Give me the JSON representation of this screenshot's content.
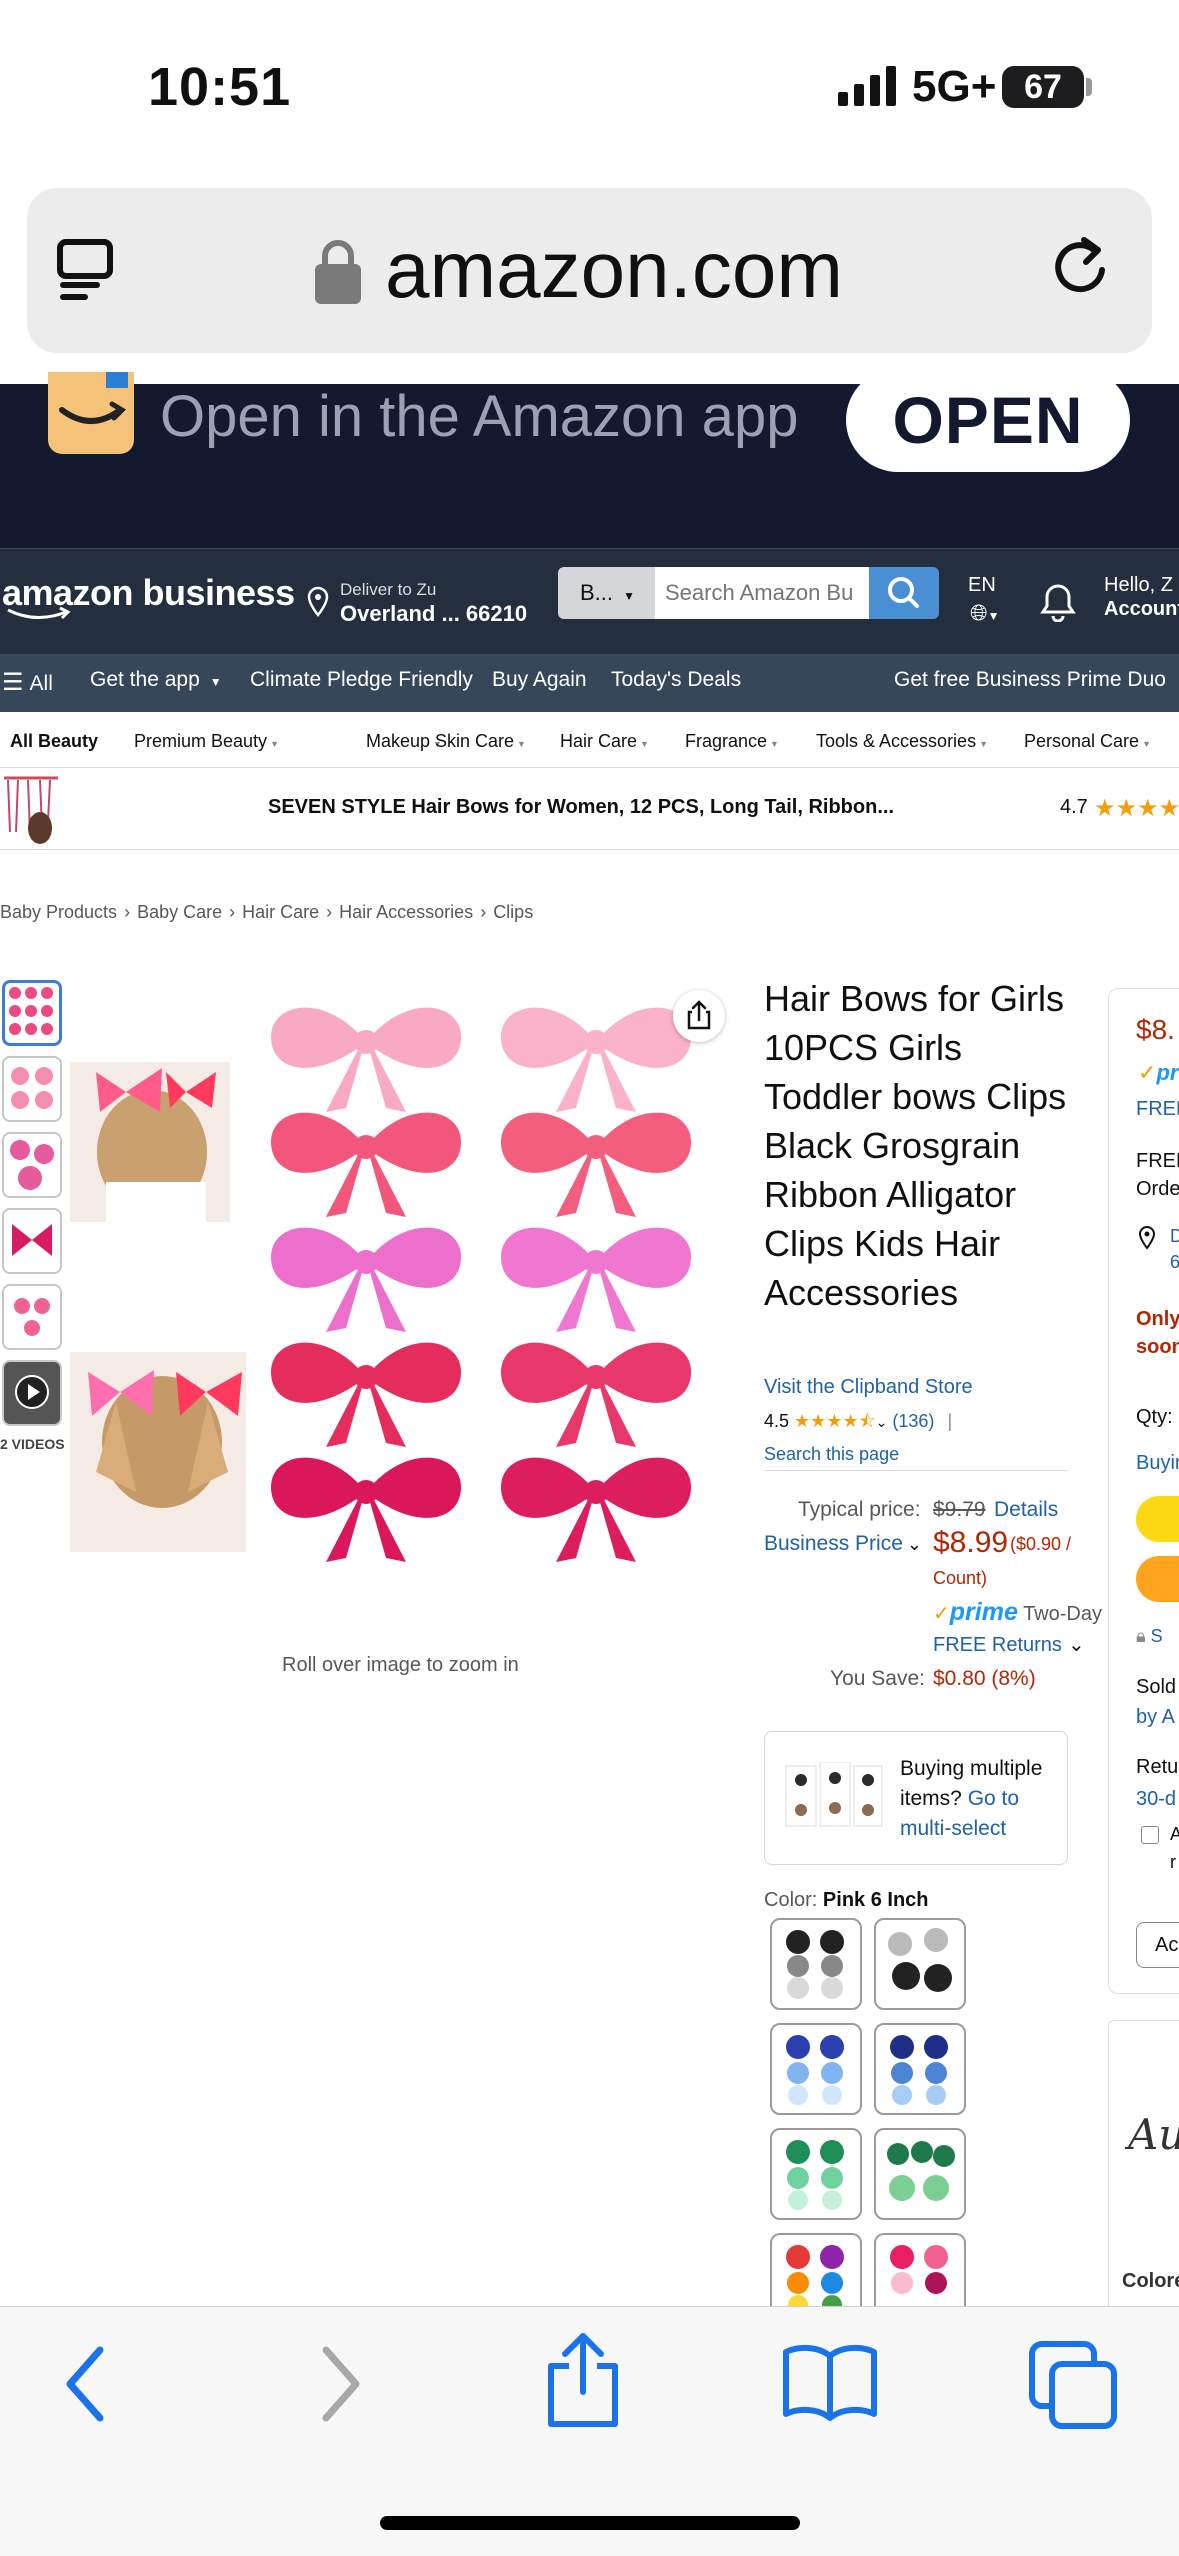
{
  "status_bar": {
    "time": "10:51",
    "network": "5G+",
    "battery": "67"
  },
  "browser": {
    "url": "amazon.com"
  },
  "app_banner": {
    "text": "Open in the Amazon app",
    "open_label": "OPEN"
  },
  "header": {
    "logo": "amazon business",
    "deliver_line1": "Deliver to Zu",
    "deliver_line2": "Overland ... 66210",
    "search_category": "B...",
    "search_placeholder": "Search Amazon Bu",
    "lang": "EN",
    "hello_line1": "Hello, Z",
    "hello_line2": "Account"
  },
  "nav": {
    "all": "All",
    "items": [
      "Get the app",
      "Climate Pledge Friendly",
      "Buy Again",
      "Today's Deals",
      "Get free Business Prime Duo"
    ]
  },
  "categories": [
    "All Beauty",
    "Premium Beauty",
    "Makeup",
    "Skin Care",
    "Hair Care",
    "Fragrance",
    "Tools & Accessories",
    "Personal Care"
  ],
  "sticky": {
    "title": "SEVEN STYLE Hair Bows for Women, 12 PCS, Long Tail, Ribbon...",
    "rating": "4.7"
  },
  "breadcrumb": [
    "Baby Products",
    "Baby Care",
    "Hair Care",
    "Hair Accessories",
    "Clips"
  ],
  "gallery": {
    "videos_label": "2 VIDEOS",
    "zoom_hint": "Roll over image to zoom in"
  },
  "product": {
    "title": "Hair Bows for Girls 10PCS Girls Toddler bows Clips Black Grosgrain Ribbon Alligator Clips Kids Hair Accessories",
    "store_link": "Visit the Clipband Store",
    "rating": "4.5",
    "rating_count": "(136)",
    "rating_sep": "|",
    "search_page": "Search this page",
    "typical_label": "Typical price:",
    "typical_price": "$9.79",
    "details": "Details",
    "business_price_label": "Business Price",
    "business_price": "$8.99",
    "unit_price_a": "($0.90 /",
    "unit_price_b": "Count)",
    "prime": "prime",
    "two_day": "Two-Day",
    "free_returns": "FREE Returns",
    "you_save_label": "You Save:",
    "you_save_value": "$0.80 (8%)",
    "multi_text": "Buying multiple items?",
    "multi_link": "Go to multi-select",
    "color_label": "Color:",
    "color_value": "Pink 6 Inch"
  },
  "buybox": {
    "price": "$8.",
    "prime": "pr",
    "free": "FREE",
    "free2": "FREE",
    "order": "Orde",
    "d": "D",
    "six": "6",
    "only": "Only",
    "soon": "soon",
    "qty": "Qty:",
    "buyin": "Buyin",
    "secure": "S",
    "sold": "Sold",
    "bya": "by A",
    "retu": "Retu",
    "thirty": "30-d",
    "a": "A",
    "r": "r",
    "add": "Ac"
  },
  "ad": {
    "logo": "Au",
    "colors": "Colore"
  },
  "colors": {
    "amazon_dark": "#232f3e",
    "nav": "#37475a",
    "price_red": "#b12704",
    "link_blue": "#2162a1",
    "prime_blue": "#1a98ff",
    "bow_pink": "#f06292"
  }
}
